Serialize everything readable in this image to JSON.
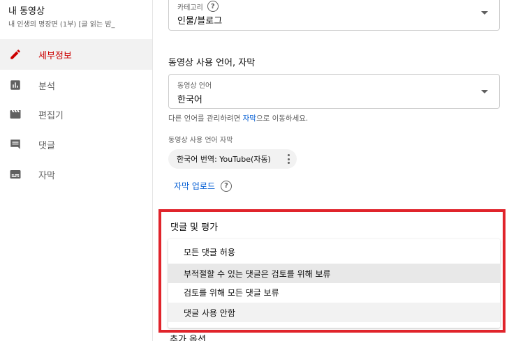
{
  "sidebar": {
    "video_title": "내 동영상",
    "video_subtitle": "내 인생의 명장면 (1부) [글 읽는 밤_",
    "items": [
      {
        "label": "세부정보",
        "icon": "pencil-icon",
        "active": true
      },
      {
        "label": "분석",
        "icon": "bar-chart-icon",
        "active": false
      },
      {
        "label": "편집기",
        "icon": "clapperboard-icon",
        "active": false
      },
      {
        "label": "댓글",
        "icon": "comment-icon",
        "active": false
      },
      {
        "label": "자막",
        "icon": "subtitles-icon",
        "active": false
      }
    ]
  },
  "category": {
    "label": "카테고리",
    "value": "인물/블로그"
  },
  "language_section": {
    "title": "동영상 사용 언어, 자막",
    "field_label": "동영상 언어",
    "field_value": "한국어",
    "helper_prefix": "다른 언어를 관리하려면 ",
    "helper_link": "자막",
    "helper_suffix": "으로 이동하세요.",
    "subtitle_label": "동영상 사용 언어 자막",
    "chip_label": "한국어 번역: YouTube(자동)",
    "upload_link": "자막 업로드"
  },
  "comments": {
    "title": "댓글 및 평가",
    "options": [
      "모든 댓글 허용",
      "부적절할 수 있는 댓글은 검토를 위해 보류",
      "검토를 위해 모든 댓글 보류",
      "댓글 사용 안함"
    ]
  },
  "next_section_partial": "추가 옵션",
  "colors": {
    "accent": "#cc0000",
    "link": "#065fd4",
    "highlight_border": "#e0242b"
  }
}
